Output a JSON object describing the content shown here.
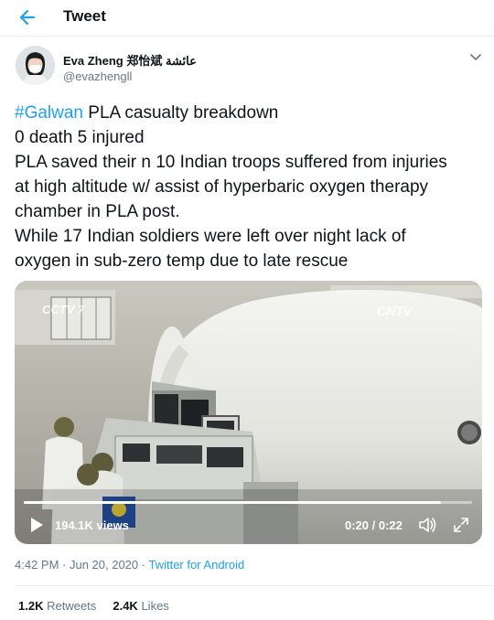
{
  "header": {
    "title": "Tweet"
  },
  "author": {
    "name": "Eva Zheng 郑怡斌 عائشة",
    "handle": "@evazhengll"
  },
  "tweet": {
    "hashtag": "#Galwan",
    "line1_rest": " PLA casualty breakdown",
    "lines": [
      "0 death 5 injured",
      "PLA saved their n 10 Indian troops suffered from injuries",
      "at high altitude w/ assist of hyperbaric oxygen therapy",
      "chamber in PLA post.",
      "While 17 Indian soldiers were left over night lack of",
      "oxygen in sub-zero temp due to late rescue"
    ]
  },
  "video": {
    "views": "194.1K views",
    "time": "0:20 / 0:22",
    "progress": 0.93,
    "watermark_left": "CCTV 7",
    "watermark_right": "CNTV"
  },
  "meta": {
    "timestamp": "4:42 PM · Jun 20, 2020 · ",
    "source": "Twitter for Android"
  },
  "stats": {
    "retweets_count": "1.2K",
    "retweets_label": "Retweets",
    "likes_count": "2.4K",
    "likes_label": "Likes"
  },
  "icons": {
    "back": "arrow-left",
    "more": "chevron-down",
    "play": "play",
    "volume": "speaker",
    "fullscreen": "expand"
  },
  "colors": {
    "accent": "#1da1f2",
    "secondary_text": "#657786",
    "primary_text": "#0f1419"
  }
}
